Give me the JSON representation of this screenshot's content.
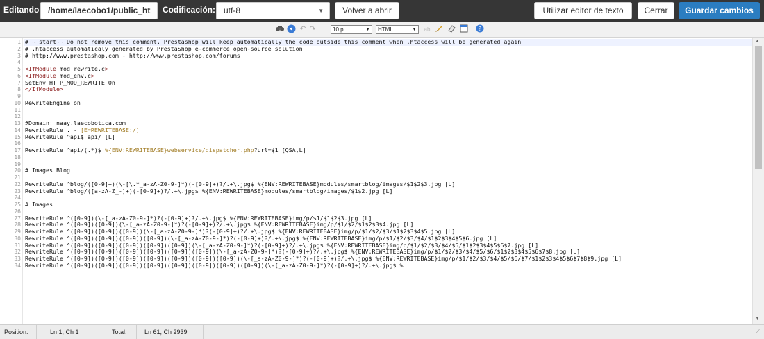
{
  "topbar": {
    "editing_label": "Editando:",
    "path_value": "/home/laecobo1/public_ht",
    "encoding_label": "Codificación:",
    "encoding_value": "utf-8",
    "reopen_label": "Volver a abrir",
    "text_editor_label": "Utilizar editor de texto",
    "close_label": "Cerrar",
    "save_label": "Guardar cambios",
    "save_color": "#2b7dc1"
  },
  "toolbar": {
    "font_size": "10 pt",
    "syntax": "HTML",
    "icons": [
      "find-icon",
      "goto-icon",
      "undo-icon",
      "redo-icon",
      "font-size-select",
      "syntax-select",
      "highlight-toggle-icon",
      "reset-highlight-icon",
      "eraser-icon",
      "fullscreen-icon",
      "help-icon"
    ]
  },
  "code": {
    "lines": [
      {
        "n": "1",
        "t": "# ~~start~~ Do not remove this comment, Prestashop will keep automatically the code outside this comment when .htaccess will be generated again"
      },
      {
        "n": "2",
        "t": "# .htaccess automaticaly generated by PrestaShop e-commerce open-source solution"
      },
      {
        "n": "3",
        "t": "# http://www.prestashop.com - http://www.prestashop.com/forums"
      },
      {
        "n": "4",
        "t": ""
      },
      {
        "n": "5",
        "t": "<IfModule mod_rewrite.c>"
      },
      {
        "n": "6",
        "t": "<IfModule mod_env.c>"
      },
      {
        "n": "7",
        "t": "SetEnv HTTP_MOD_REWRITE On"
      },
      {
        "n": "8",
        "t": "</IfModule>"
      },
      {
        "n": "9",
        "t": ""
      },
      {
        "n": "10",
        "t": "RewriteEngine on"
      },
      {
        "n": "11",
        "t": ""
      },
      {
        "n": "12",
        "t": ""
      },
      {
        "n": "13",
        "t": "#Domain: naay.laecobotica.com"
      },
      {
        "n": "14",
        "t": "RewriteRule . - [E=REWRITEBASE:/]"
      },
      {
        "n": "15",
        "t": "RewriteRule ^api$ api/ [L]"
      },
      {
        "n": "16",
        "t": ""
      },
      {
        "n": "17",
        "t": "RewriteRule ^api/(.*)$ %{ENV:REWRITEBASE}webservice/dispatcher.php?url=$1 [QSA,L]"
      },
      {
        "n": "18",
        "t": ""
      },
      {
        "n": "19",
        "t": ""
      },
      {
        "n": "20",
        "t": "# Images Blog"
      },
      {
        "n": "21",
        "t": ""
      },
      {
        "n": "22",
        "t": "RewriteRule ^blog/([0-9]+)(\\-[\\.*_a-zA-Z0-9-]*)(-[0-9]+)?/.+\\.jpg$ %{ENV:REWRITEBASE}modules/smartblog/images/$1$2$3.jpg [L]"
      },
      {
        "n": "23",
        "t": "RewriteRule ^blog/([a-zA-Z_-]+)(-[0-9]+)?/.+\\.jpg$ %{ENV:REWRITEBASE}modules/smartblog/images/$1$2.jpg [L]"
      },
      {
        "n": "24",
        "t": ""
      },
      {
        "n": "25",
        "t": "# Images"
      },
      {
        "n": "26",
        "t": ""
      },
      {
        "n": "27",
        "t": "RewriteRule ^([0-9])(\\-[_a-zA-Z0-9-]*)?(-[0-9]+)?/.+\\.jpg$ %{ENV:REWRITEBASE}img/p/$1/$1$2$3.jpg [L]"
      },
      {
        "n": "28",
        "t": "RewriteRule ^([0-9])([0-9])(\\-[_a-zA-Z0-9-]*)?(-[0-9]+)?/.+\\.jpg$ %{ENV:REWRITEBASE}img/p/$1/$2/$1$2$3$4.jpg [L]"
      },
      {
        "n": "29",
        "t": "RewriteRule ^([0-9])([0-9])([0-9])(\\-[_a-zA-Z0-9-]*)?(-[0-9]+)?/.+\\.jpg$ %{ENV:REWRITEBASE}img/p/$1/$2/$3/$1$2$3$4$5.jpg [L]"
      },
      {
        "n": "30",
        "t": "RewriteRule ^([0-9])([0-9])([0-9])([0-9])(\\-[_a-zA-Z0-9-]*)?(-[0-9]+)?/.+\\.jpg$ %{ENV:REWRITEBASE}img/p/$1/$2/$3/$4/$1$2$3$4$5$6.jpg [L]"
      },
      {
        "n": "31",
        "t": "RewriteRule ^([0-9])([0-9])([0-9])([0-9])([0-9])(\\-[_a-zA-Z0-9-]*)?(-[0-9]+)?/.+\\.jpg$ %{ENV:REWRITEBASE}img/p/$1/$2/$3/$4/$5/$1$2$3$4$5$6$7.jpg [L]"
      },
      {
        "n": "32",
        "t": "RewriteRule ^([0-9])([0-9])([0-9])([0-9])([0-9])([0-9])(\\-[_a-zA-Z0-9-]*)?(-[0-9]+)?/.+\\.jpg$ %{ENV:REWRITEBASE}img/p/$1/$2/$3/$4/$5/$6/$1$2$3$4$5$6$7$8.jpg [L]"
      },
      {
        "n": "33",
        "t": "RewriteRule ^([0-9])([0-9])([0-9])([0-9])([0-9])([0-9])([0-9])(\\-[_a-zA-Z0-9-]*)?(-[0-9]+)?/.+\\.jpg$ %{ENV:REWRITEBASE}img/p/$1/$2/$3/$4/$5/$6/$7/$1$2$3$4$5$6$7$8$9.jpg [L]"
      },
      {
        "n": "34",
        "t": "RewriteRule ^([0-9])([0-9])([0-9])([0-9])([0-9])([0-9])([0-9])([0-9])(\\-[_a-zA-Z0-9-]*)?(-[0-9]+)?/.+\\.jpg$ %"
      }
    ]
  },
  "status": {
    "position_label": "Position:",
    "position_value": "Ln 1, Ch 1",
    "total_label": "Total:",
    "total_value": "Ln 61, Ch 2939"
  }
}
